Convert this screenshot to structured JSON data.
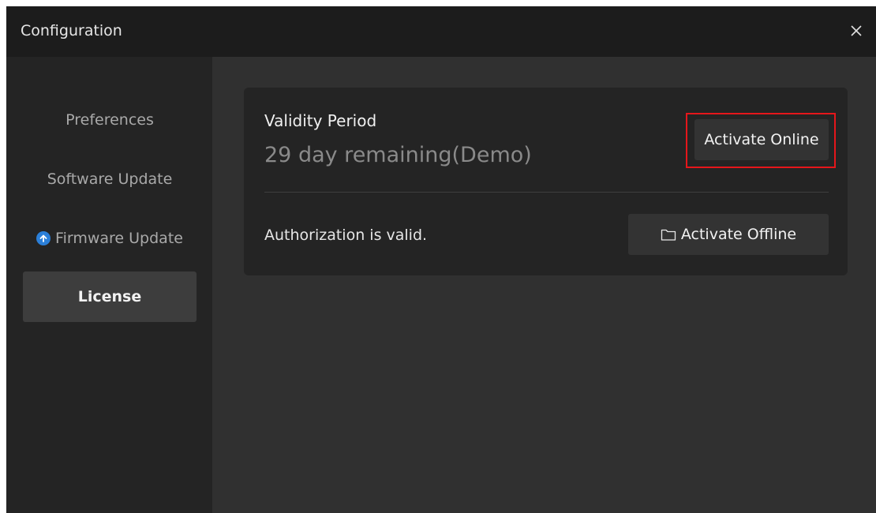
{
  "window": {
    "title": "Configuration"
  },
  "sidebar": {
    "items": [
      {
        "label": "Preferences",
        "active": false
      },
      {
        "label": "Software Update",
        "active": false
      },
      {
        "label": "Firmware Update",
        "active": false,
        "icon": "upload-arrow-icon"
      },
      {
        "label": "License",
        "active": true
      }
    ]
  },
  "license": {
    "validity_label": "Validity Period",
    "remaining": "29 day remaining(Demo)",
    "activate_online_label": "Activate Online",
    "authorization_status": "Authorization is valid.",
    "activate_offline_label": "Activate Offline",
    "activate_offline_icon": "folder-icon"
  },
  "colors": {
    "highlight": "#e5161b",
    "accent_blue": "#2b7fd8"
  }
}
